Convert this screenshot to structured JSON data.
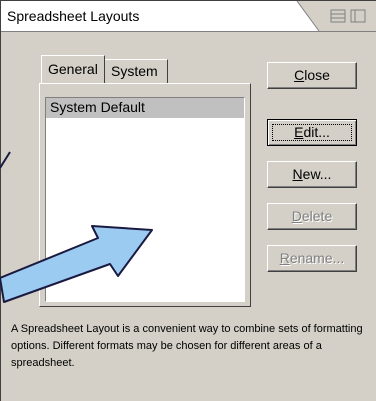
{
  "window": {
    "title": "Spreadsheet Layouts"
  },
  "tabs": [
    {
      "label": "General",
      "active": true
    },
    {
      "label": "System",
      "active": false
    }
  ],
  "list": {
    "items": [
      {
        "label": "System Default",
        "selected": true
      }
    ]
  },
  "buttons": {
    "close": {
      "label": "Close",
      "mnemonic": "C",
      "rest": "lose"
    },
    "edit": {
      "label": "Edit...",
      "mnemonic": "E",
      "rest": "dit..."
    },
    "new": {
      "label": "New...",
      "mnemonic": "N",
      "rest": "ew..."
    },
    "delete": {
      "label": "Delete",
      "mnemonic": "D",
      "rest": "elete",
      "disabled": true
    },
    "rename": {
      "label": "Rename...",
      "mnemonic": "R",
      "rest": "ename...",
      "disabled": true
    }
  },
  "description": "A Spreadsheet Layout is a convenient way to combine sets of formatting options. Different formats may be chosen for different areas of a spreadsheet.",
  "colors": {
    "dialog_bg": "#d4d0c8",
    "arrow_fill": "#9ccbf2",
    "arrow_stroke": "#1a1a40"
  }
}
